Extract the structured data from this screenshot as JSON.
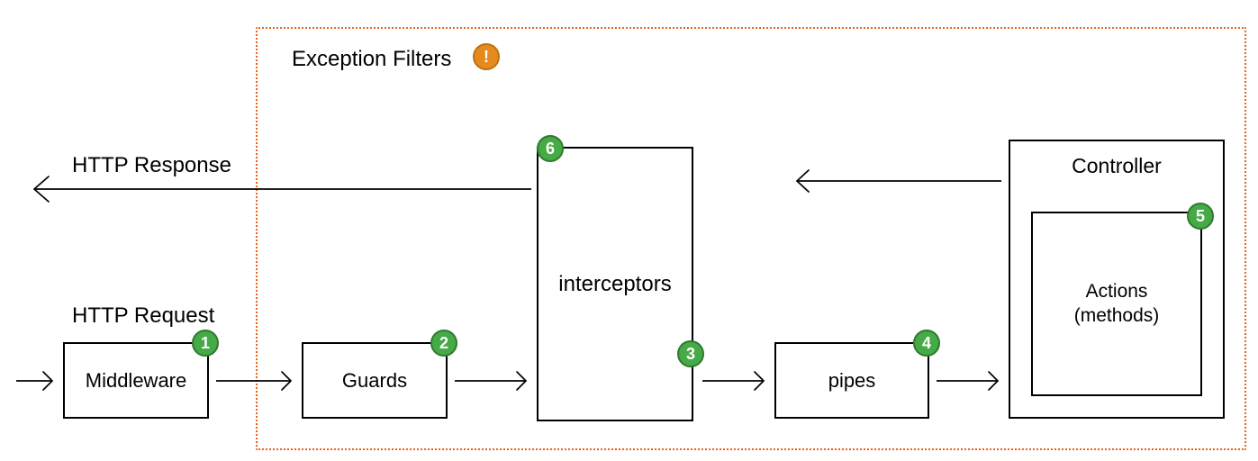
{
  "labels": {
    "http_response": "HTTP Response",
    "http_request": "HTTP Request",
    "exception_filters": "Exception Filters"
  },
  "boxes": {
    "middleware": "Middleware",
    "guards": "Guards",
    "interceptors": "interceptors",
    "pipes": "pipes",
    "controller": "Controller",
    "actions_line1": "Actions",
    "actions_line2": "(methods)"
  },
  "badges": {
    "b1": "1",
    "b2": "2",
    "b3": "3",
    "b4": "4",
    "b5": "5",
    "b6": "6",
    "ex": "!"
  },
  "colors": {
    "badge_green": "#46aa47",
    "badge_orange": "#e58a1f",
    "dotted_orange": "#e8641b"
  },
  "diagram": {
    "flow_request": [
      "HTTP Request",
      "Middleware",
      "Guards",
      "interceptors",
      "pipes",
      "Controller.Actions"
    ],
    "flow_response": [
      "Controller.Actions",
      "interceptors",
      "HTTP Response"
    ],
    "exception_scope": [
      "Guards",
      "interceptors",
      "pipes",
      "Controller"
    ],
    "numbered_order": {
      "1": "Middleware",
      "2": "Guards",
      "3": "interceptors (request path)",
      "4": "pipes",
      "5": "Actions (methods)",
      "6": "interceptors (response path)"
    }
  }
}
